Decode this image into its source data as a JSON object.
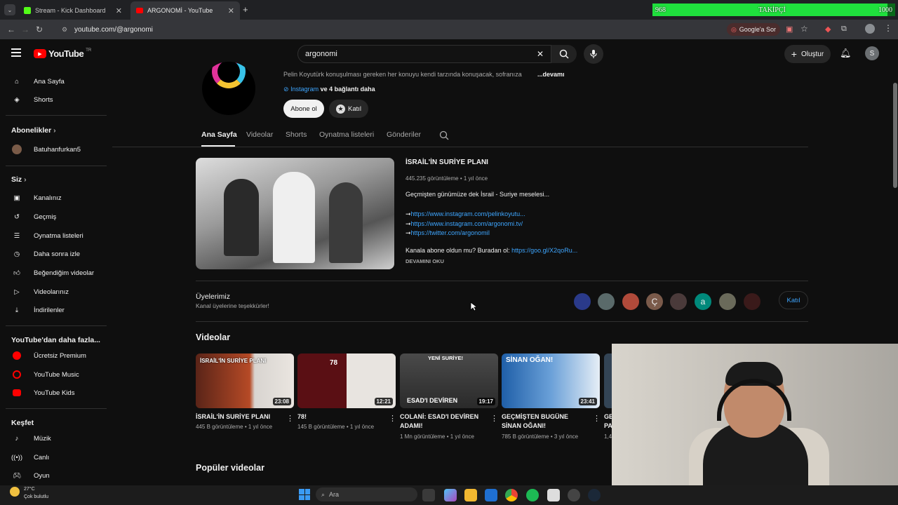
{
  "browser": {
    "tabs": [
      {
        "label": "Stream - Kick Dashboard"
      },
      {
        "label": "ARGONOMİ - YouTube"
      }
    ],
    "url": "youtube.com/@argonomi",
    "ask_google": "Google'a Sor"
  },
  "overlay": {
    "left": "968",
    "center": "TAKİPÇİ",
    "right": "1000",
    "progress": 0.968
  },
  "header": {
    "logo_text": "YouTube",
    "region": "TR",
    "search_value": "argonomi",
    "create_label": "Oluştur",
    "avatar_letter": "S"
  },
  "sidebar": {
    "top": [
      {
        "label": "Ana Sayfa",
        "icon": "home-icon"
      },
      {
        "label": "Shorts",
        "icon": "shorts-icon"
      }
    ],
    "subs_title": "Abonelikler",
    "subs": [
      {
        "label": "Batuhanfurkan5"
      }
    ],
    "you_title": "Siz",
    "you": [
      {
        "label": "Kanalınız"
      },
      {
        "label": "Geçmiş"
      },
      {
        "label": "Oynatma listeleri"
      },
      {
        "label": "Daha sonra izle"
      },
      {
        "label": "Beğendiğim videolar"
      },
      {
        "label": "Videolarınız"
      },
      {
        "label": "İndirilenler"
      }
    ],
    "more_title": "YouTube'dan daha fazla...",
    "more": [
      {
        "label": "Ücretsiz Premium"
      },
      {
        "label": "YouTube Music"
      },
      {
        "label": "YouTube Kids"
      }
    ],
    "explore_title": "Keşfet",
    "explore": [
      {
        "label": "Müzik"
      },
      {
        "label": "Canlı"
      },
      {
        "label": "Oyun"
      }
    ]
  },
  "channel": {
    "description": "Pelin Koyutürk konuşulması gereken her konuyu kendi tarzında konuşacak, sofranıza",
    "more": "...devamı",
    "link_text": "Instagram",
    "link_more": "ve 4 bağlantı daha",
    "subscribe": "Abone ol",
    "join": "Katıl"
  },
  "tabs": [
    "Ana Sayfa",
    "Videolar",
    "Shorts",
    "Oynatma listeleri",
    "Gönderiler"
  ],
  "featured": {
    "title": "İSRAİL'İN SURİYE PLANI",
    "meta": "445.235 görüntüleme • 1 yıl önce",
    "desc": "Geçmişten günümüze dek İsrail - Suriye meselesi...",
    "links": [
      "https://www.instagram.com/pelinkoyutu...",
      "https://www.instagram.com/argonomi.tv/",
      "https://twitter.com/argonomiI"
    ],
    "cta_text": "Kanala abone oldun mu? Buradan ol:",
    "cta_link": "https://goo.gl/X2qoRu...",
    "read_more": "DEVAMINI OKU"
  },
  "members": {
    "title": "Üyelerimiz",
    "subtitle": "Kanal üyelerine teşekkürler!",
    "join": "Katıl",
    "letters": [
      "Ç",
      "a"
    ]
  },
  "videos_section": {
    "title": "Videolar",
    "items": [
      {
        "title": "İSRAİL'İN SURİYE PLANI",
        "meta": "445 B görüntüleme • 1 yıl önce",
        "duration": "23:08",
        "thumb_text": "İSRAİL'İN SURİYE PLANI"
      },
      {
        "title": "78!",
        "meta": "145 B görüntüleme • 1 yıl önce",
        "duration": "12:21",
        "thumb_text": "78"
      },
      {
        "title": "COLANİ: ESAD'I DEVİREN ADAMI!",
        "meta": "1 Mn görüntüleme • 1 yıl önce",
        "duration": "19:17",
        "thumb_text": "ESAD'I DEVİREN",
        "thumb_text2": "YENİ SURİYE!"
      },
      {
        "title": "GEÇMİŞTEN BUGÜNE SİNAN OĞANI!",
        "meta": "785 B görüntüleme • 3 yıl önce",
        "duration": "23:41",
        "thumb_text": "SİNAN OĞAN!"
      }
    ],
    "partial": {
      "title": "GE PA",
      "meta": "1,4"
    }
  },
  "popular_title": "Popüler videolar",
  "taskbar": {
    "weather_temp": "27°C",
    "weather_desc": "Çok bulutlu",
    "search": "Ara"
  }
}
